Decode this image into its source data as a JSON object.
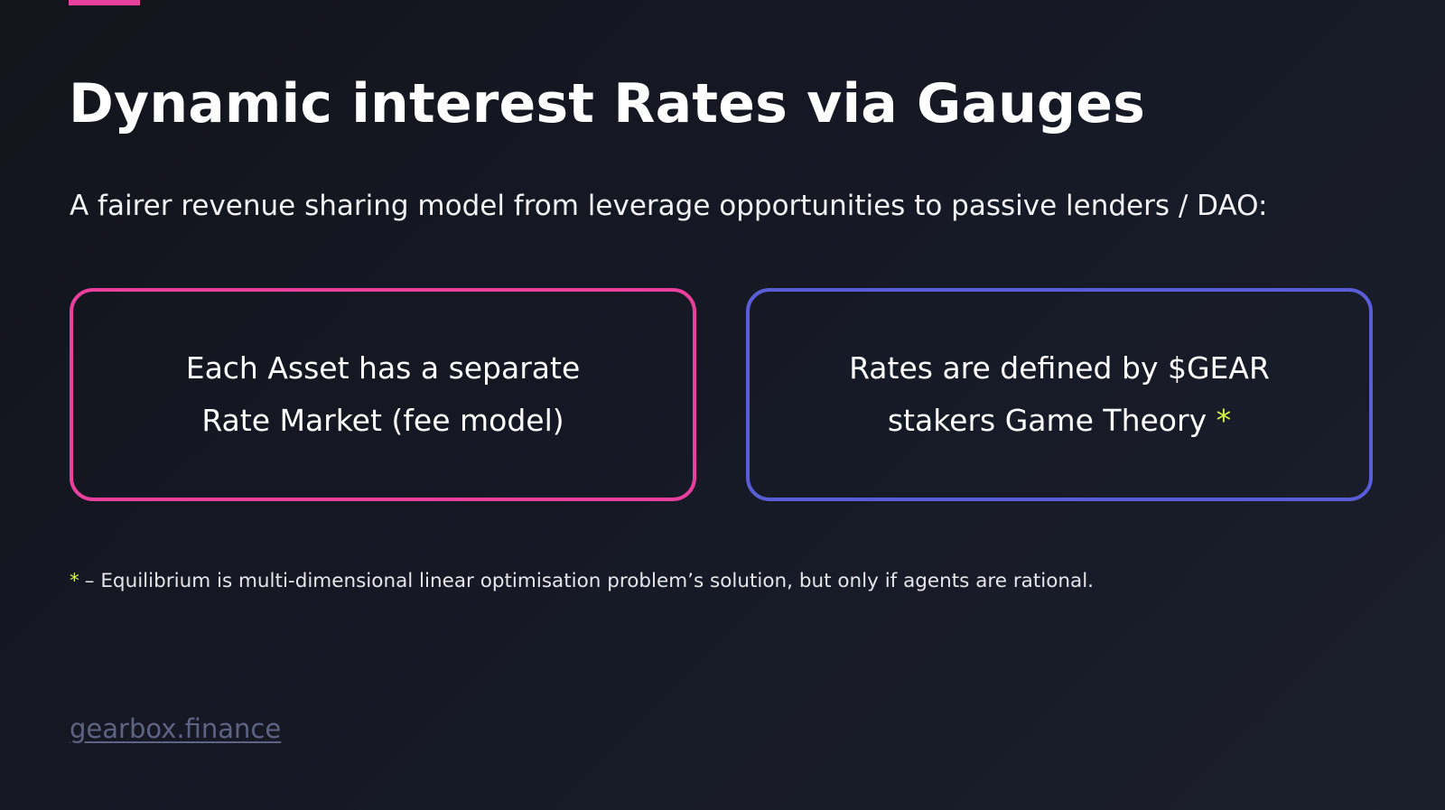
{
  "slide": {
    "title": "Dynamic interest Rates via Gauges",
    "subtitle": "A fairer revenue sharing model from leverage opportunities to passive lenders / DAO:",
    "cards": [
      {
        "lines": [
          "Each Asset has a separate",
          "Rate Market (fee model)"
        ],
        "border_color": "#e8409c"
      },
      {
        "lines": [
          "Rates are defined by $GEAR",
          "stakers Game Theory"
        ],
        "marker": "*",
        "border_color": "#5a5ed6"
      }
    ],
    "footnote": {
      "marker": "*",
      "text": "– Equilibrium is multi-dimensional linear optimisation problem’s solution, but only if agents are rational."
    },
    "footer_link": "gearbox.finance"
  },
  "colors": {
    "accent_pink": "#e8409c",
    "accent_blue": "#5a5ed6",
    "marker_yellow": "#d8f24a",
    "link_gray": "#5d6384"
  }
}
